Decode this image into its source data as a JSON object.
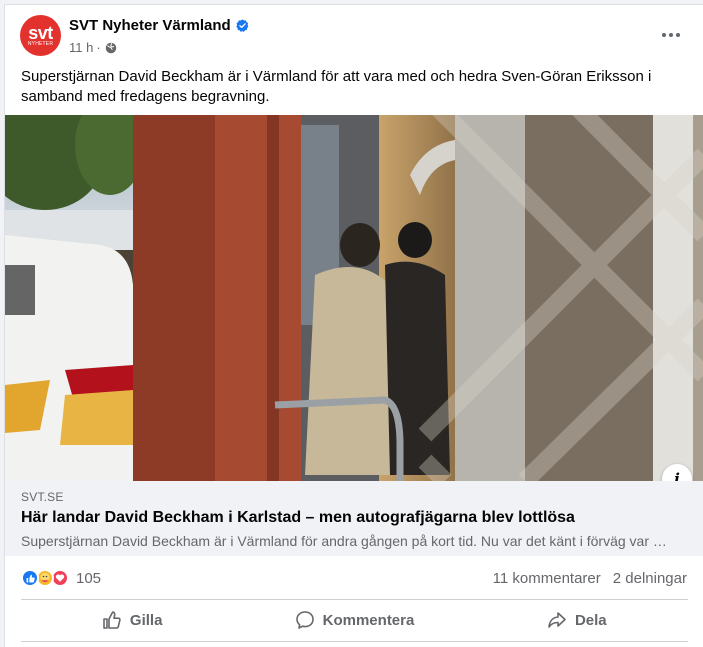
{
  "post": {
    "page_name": "SVT Nyheter Värmland",
    "avatar": {
      "logo_main": "svt",
      "logo_sub": "NYHETER",
      "color": "#e3312d"
    },
    "time": "11 h",
    "dot": "·",
    "text": "Superstjärnan David Beckham är i Värmland för att vara med och hedra Sven-Göran Eriksson i samband med fredagens begravning."
  },
  "link": {
    "domain": "SVT.SE",
    "title": "Här landar David Beckham i Karlstad – men autografjägarna blev lottlösa",
    "description": "Superstjärnan David Beckham är i Värmland för andra gången på kort tid. Nu var det känt i förväg var han skulle landa…"
  },
  "info_icon": "i",
  "stats": {
    "reaction_count": "105",
    "comments": "11 kommentarer",
    "shares": "2 delningar",
    "reaction_icons": [
      "like-icon",
      "care-icon",
      "love-icon"
    ]
  },
  "actions": {
    "like": "Gilla",
    "comment": "Kommentera",
    "share": "Dela"
  },
  "colors": {
    "verified": "#1877f2",
    "secondary_text": "#65676b",
    "link_bg": "#f0f2f5"
  }
}
